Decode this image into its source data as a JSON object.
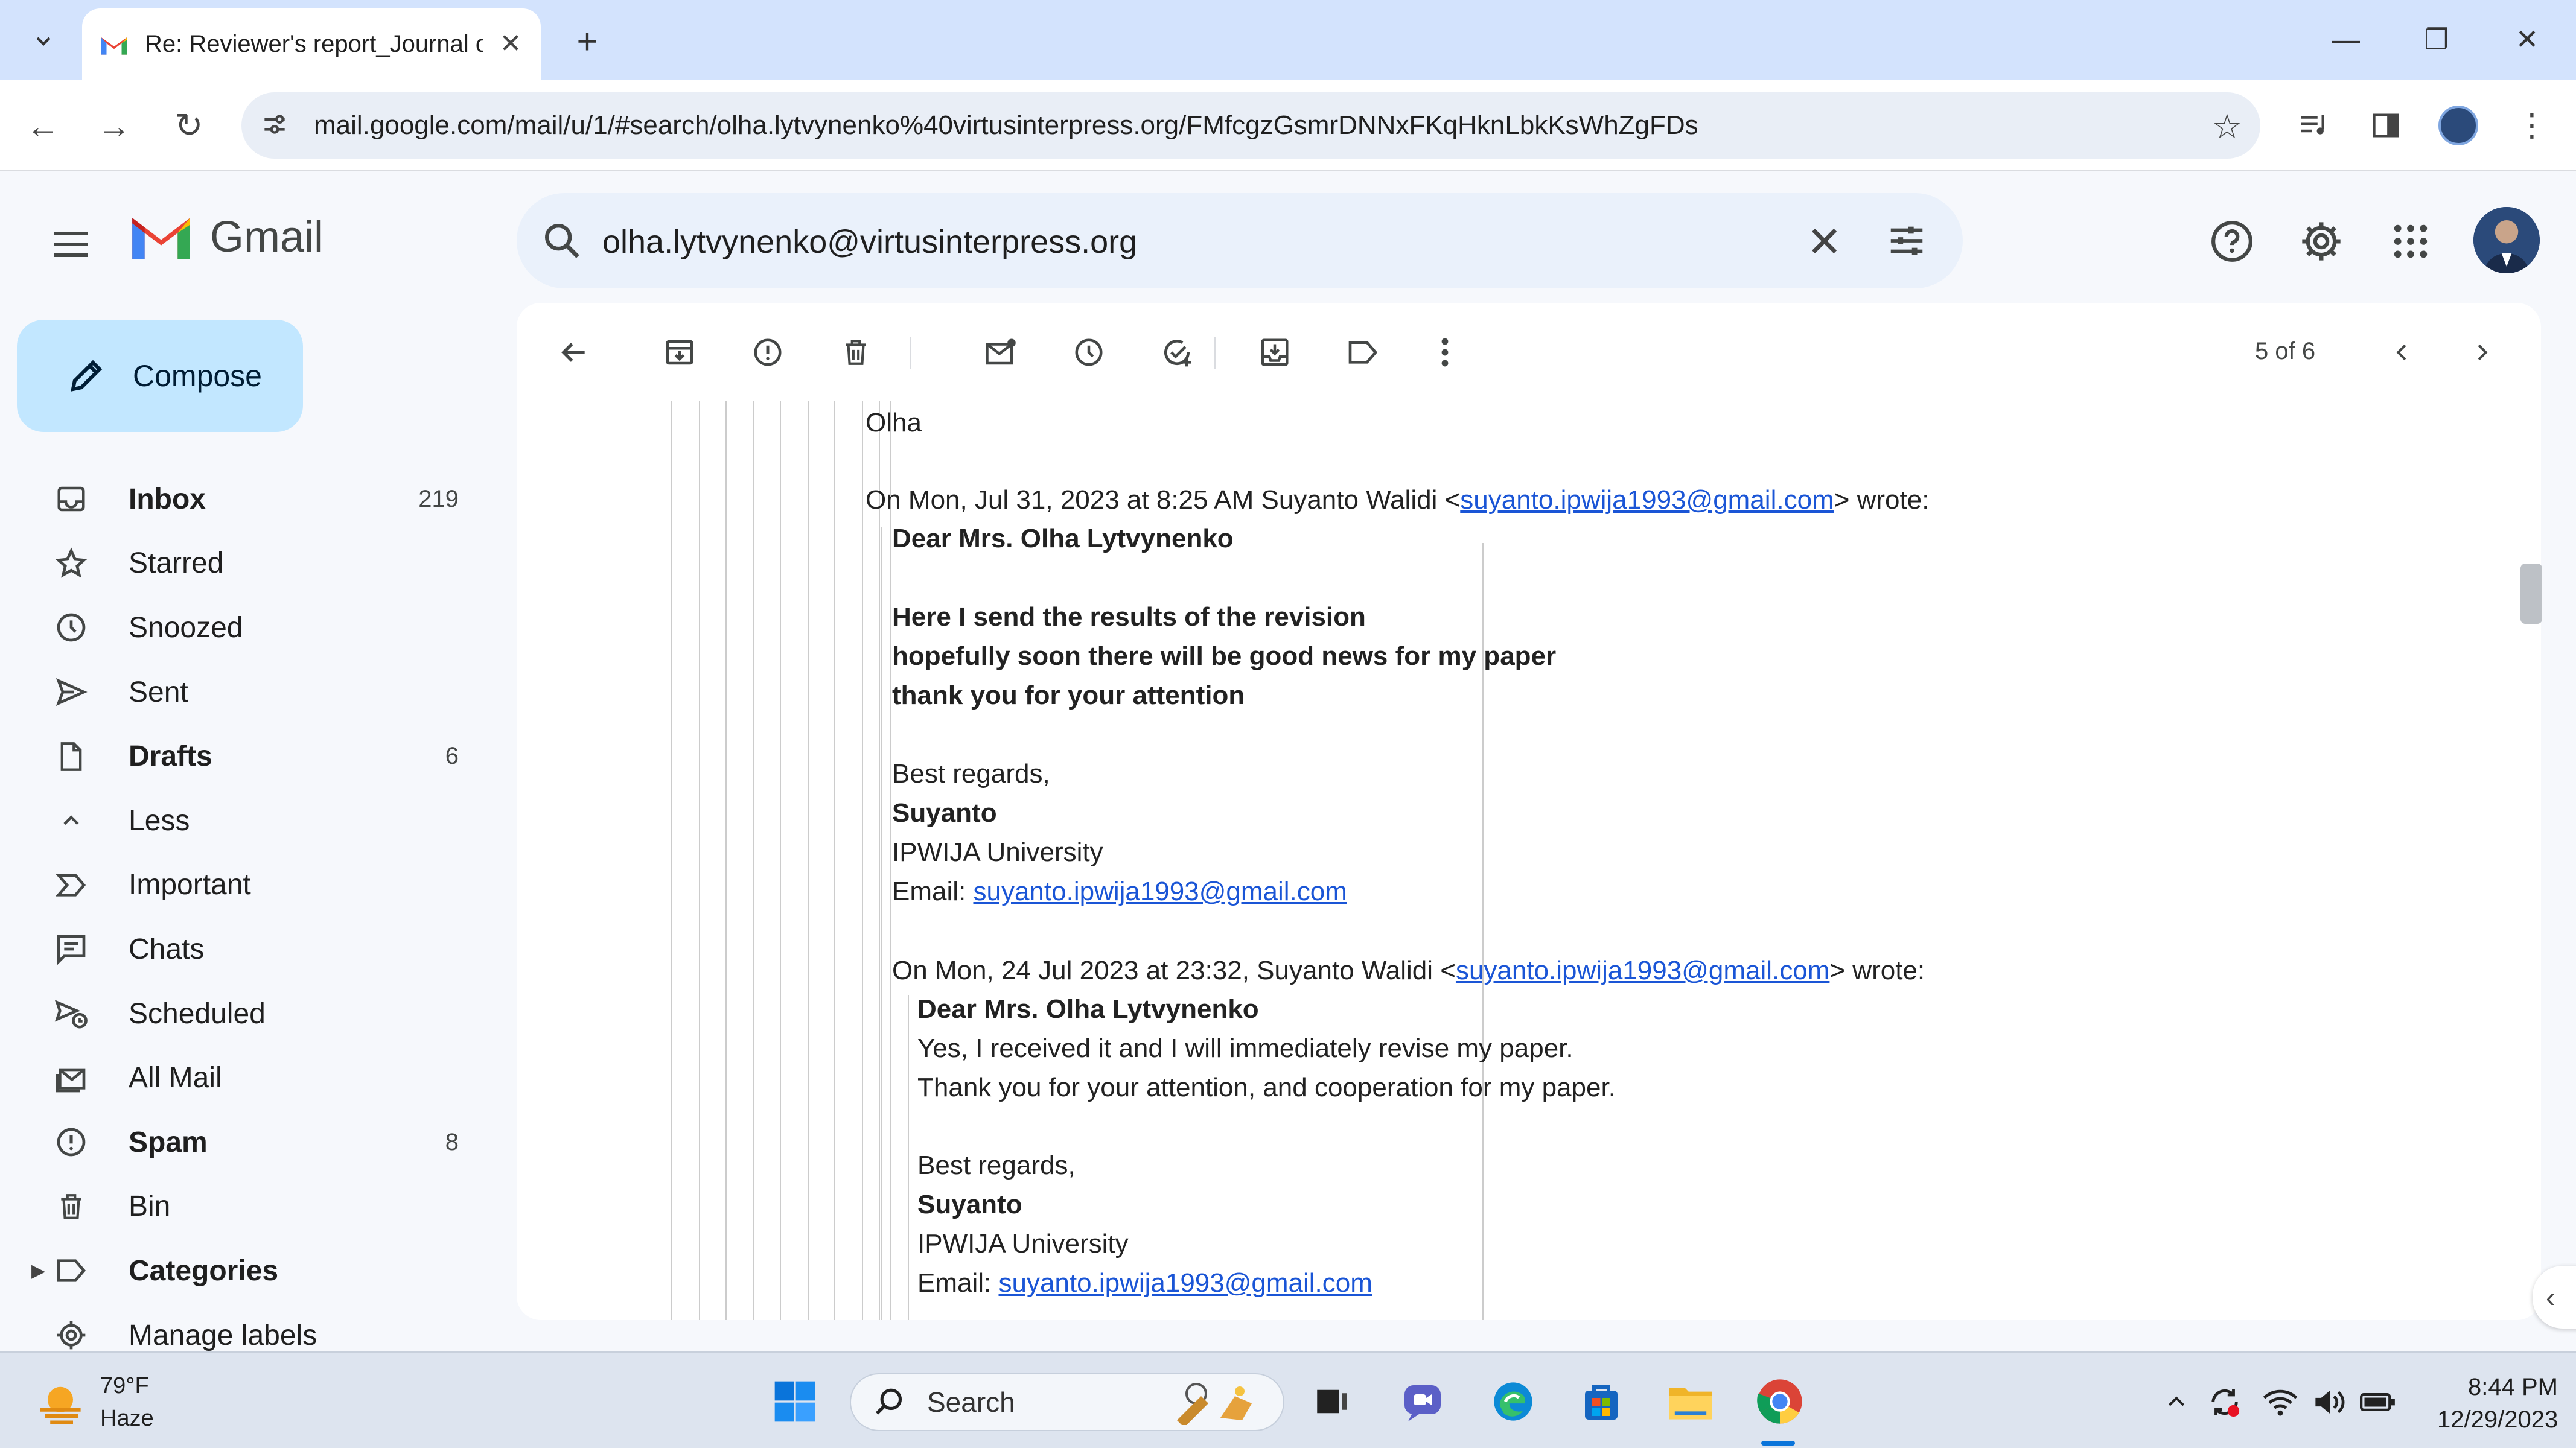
{
  "browser": {
    "tab_title": "Re: Reviewer's report_Journal of",
    "url": "mail.google.com/mail/u/1/#search/olha.lytvynenko%40virtusinterpress.org/FMfcgzGsmrDNNxFKqHknLbkKsWhZgFDs"
  },
  "gmail": {
    "logo_text": "Gmail",
    "search_query": "olha.lytvynenko@virtusinterpress.org",
    "compose_label": "Compose",
    "nav": [
      {
        "label": "Inbox",
        "count": "219",
        "bold": true
      },
      {
        "label": "Starred",
        "count": ""
      },
      {
        "label": "Snoozed",
        "count": ""
      },
      {
        "label": "Sent",
        "count": ""
      },
      {
        "label": "Drafts",
        "count": "6",
        "bold": true
      },
      {
        "label": "Less",
        "count": ""
      },
      {
        "label": "Important",
        "count": ""
      },
      {
        "label": "Chats",
        "count": ""
      },
      {
        "label": "Scheduled",
        "count": ""
      },
      {
        "label": "All Mail",
        "count": ""
      },
      {
        "label": "Spam",
        "count": "8",
        "bold": true
      },
      {
        "label": "Bin",
        "count": ""
      },
      {
        "label": "Categories",
        "count": "",
        "bold": true
      },
      {
        "label": "Manage labels",
        "count": ""
      }
    ],
    "pager": "5 of 6"
  },
  "message": {
    "signoff_name": "Olha",
    "quote1_header_pre": "On Mon, Jul 31, 2023 at 8:25 AM Suyanto Walidi <",
    "quote1_header_email": "suyanto.ipwija1993@gmail.com",
    "quote1_header_post": "> wrote:",
    "q1_greeting": "Dear Mrs. Olha Lytvynenko",
    "q1_line1": "Here I send the results of the revision",
    "q1_line2": "hopefully soon there will be good news for my paper",
    "q1_line3": "thank you for your attention",
    "q1_regards": "Best regards,",
    "q1_name": "Suyanto",
    "q1_org": "IPWIJA University",
    "q1_email_label": "Email: ",
    "q1_email": "suyanto.ipwija1993@gmail.com",
    "quote2_header_pre": "On Mon, 24 Jul 2023 at 23:32, Suyanto Walidi <",
    "quote2_header_email": "suyanto.ipwija1993@gmail.com",
    "quote2_header_post": "> wrote:",
    "q2_greeting": "Dear Mrs. Olha Lytvynenko",
    "q2_line1": "Yes, I received it and I will immediately revise my paper.",
    "q2_line2": "Thank you for your attention, and cooperation for my paper.",
    "q2_regards": "Best regards,",
    "q2_name": "Suyanto",
    "q2_org": "IPWIJA University",
    "q2_email_label": "Email: ",
    "q2_email": "suyanto.ipwija1993@gmail.com"
  },
  "taskbar": {
    "temperature": "79°F",
    "weather": "Haze",
    "search_label": "Search",
    "time": "8:44 PM",
    "date": "12/29/2023"
  },
  "colors": {
    "link": "#1a55d6",
    "compose_bg": "#c2e7ff",
    "tab_strip": "#d3e3fd",
    "gmail_red": "#ea4335"
  }
}
